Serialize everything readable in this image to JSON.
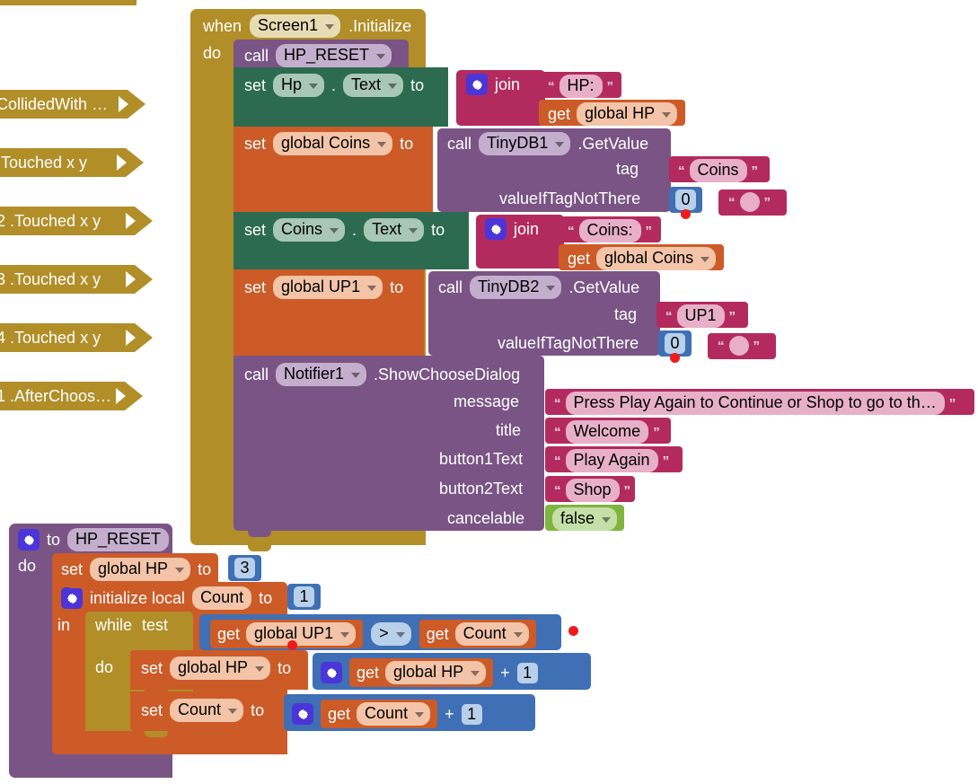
{
  "app": {
    "title": "MIT App Inventor Blocks Editor",
    "canvas_background": "#ffffff"
  },
  "colors": {
    "control_gold": "#b18e28",
    "procedure_purple": "#7a5485",
    "component_green": "#2c6b4f",
    "variable_orange": "#cc5b27",
    "text_pink": "#b32b5e",
    "math_blue": "#3f6fb5",
    "logic_green": "#7fb53f",
    "error_dot": "#ef1b1b"
  },
  "gutter_blocks": [
    {
      "label": "CollidedWith …",
      "kind": "collapsed-event"
    },
    {
      "label": ".Touched   x   y",
      "kind": "collapsed-event"
    },
    {
      "label": "2 .Touched   x   y",
      "kind": "collapsed-event"
    },
    {
      "label": "3 .Touched   x   y",
      "kind": "collapsed-event"
    },
    {
      "label": "4 .Touched   x   y",
      "kind": "collapsed-event"
    },
    {
      "label": "1 .AfterChoos…",
      "kind": "collapsed-event"
    }
  ],
  "event_block": {
    "when": "when",
    "component": "Screen1",
    "event": ".Initialize",
    "do": "do",
    "statements": {
      "call_proc": {
        "call": "call",
        "name": "HP_RESET"
      },
      "set_hp_text": {
        "set": "set",
        "component": "Hp",
        "dot": ".",
        "property": "Text",
        "to": "to",
        "value": {
          "join": "join",
          "args": [
            {
              "type": "text",
              "value": "HP:"
            },
            {
              "type": "get",
              "label": "get",
              "variable": "global HP"
            }
          ]
        }
      },
      "set_global_coins": {
        "set": "set",
        "variable": "global Coins",
        "to": "to",
        "value": {
          "call": "call",
          "component": "TinyDB1",
          "method": ".GetValue",
          "params": [
            {
              "name": "tag",
              "type": "text",
              "value": "Coins"
            },
            {
              "name": "valueIfTagNotThere",
              "type": "number",
              "value": "0"
            }
          ],
          "detached_text": {
            "type": "text",
            "value": ""
          },
          "has_error": true
        }
      },
      "set_coins_text": {
        "set": "set",
        "component": "Coins",
        "dot": ".",
        "property": "Text",
        "to": "to",
        "value": {
          "join": "join",
          "args": [
            {
              "type": "text",
              "value": "Coins:"
            },
            {
              "type": "get",
              "label": "get",
              "variable": "global Coins"
            }
          ]
        }
      },
      "set_global_up1": {
        "set": "set",
        "variable": "global UP1",
        "to": "to",
        "value": {
          "call": "call",
          "component": "TinyDB2",
          "method": ".GetValue",
          "params": [
            {
              "name": "tag",
              "type": "text",
              "value": "UP1"
            },
            {
              "name": "valueIfTagNotThere",
              "type": "number",
              "value": "0"
            }
          ],
          "detached_text": {
            "type": "text",
            "value": ""
          },
          "has_error": true
        }
      },
      "call_notifier": {
        "call": "call",
        "component": "Notifier1",
        "method": ".ShowChooseDialog",
        "params": [
          {
            "name": "message",
            "type": "text",
            "value": "Press Play Again to Continue or Shop to go to th…"
          },
          {
            "name": "title",
            "type": "text",
            "value": "Welcome"
          },
          {
            "name": "button1Text",
            "type": "text",
            "value": "Play Again"
          },
          {
            "name": "button2Text",
            "type": "text",
            "value": "Shop"
          },
          {
            "name": "cancelable",
            "type": "logic",
            "value": "false"
          }
        ]
      }
    }
  },
  "procedure_block": {
    "to": "to",
    "name": "HP_RESET",
    "do": "do",
    "statements": {
      "set_global_hp": {
        "set": "set",
        "variable": "global HP",
        "to": "to",
        "value": {
          "type": "number",
          "value": "3"
        }
      },
      "init_local": {
        "label": "initialize local",
        "name": "Count",
        "to": "to",
        "value": {
          "type": "number",
          "value": "1"
        },
        "in": "in",
        "body": {
          "while": "while",
          "test_label": "test",
          "test": {
            "left": {
              "label": "get",
              "variable": "global UP1",
              "has_error": true
            },
            "operator": ">",
            "right": {
              "label": "get",
              "variable": "Count"
            },
            "has_error": true
          },
          "do_label": "do",
          "do": [
            {
              "set": "set",
              "variable": "global HP",
              "to": "to",
              "value": {
                "left": {
                  "label": "get",
                  "variable": "global HP"
                },
                "operator": "+",
                "right": {
                  "type": "number",
                  "value": "1"
                }
              }
            },
            {
              "set": "set",
              "variable": "Count",
              "to": "to",
              "value": {
                "left": {
                  "label": "get",
                  "variable": "Count"
                },
                "operator": "+",
                "right": {
                  "type": "number",
                  "value": "1"
                }
              }
            }
          ]
        }
      }
    }
  }
}
